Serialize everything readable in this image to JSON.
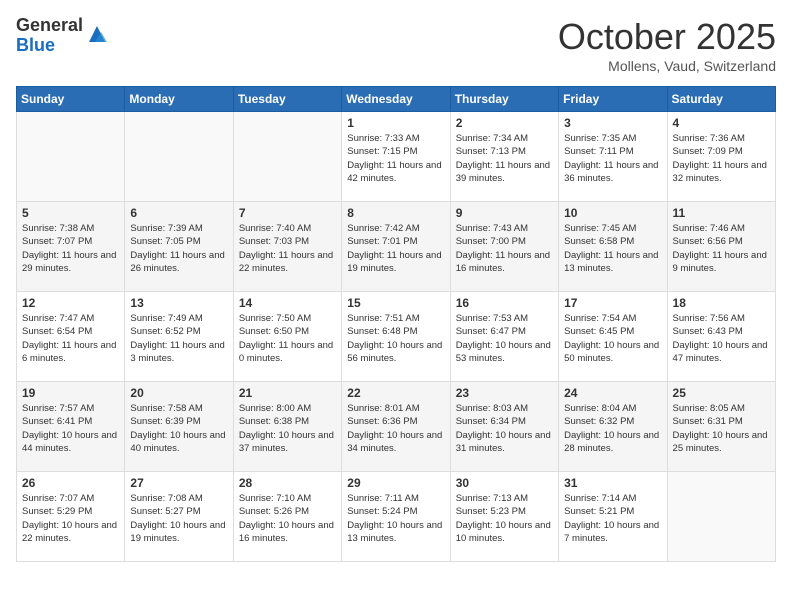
{
  "header": {
    "logo": {
      "general": "General",
      "blue": "Blue"
    },
    "title": "October 2025",
    "location": "Mollens, Vaud, Switzerland"
  },
  "days_of_week": [
    "Sunday",
    "Monday",
    "Tuesday",
    "Wednesday",
    "Thursday",
    "Friday",
    "Saturday"
  ],
  "weeks": [
    [
      {
        "day": "",
        "sunrise": "",
        "sunset": "",
        "daylight": ""
      },
      {
        "day": "",
        "sunrise": "",
        "sunset": "",
        "daylight": ""
      },
      {
        "day": "",
        "sunrise": "",
        "sunset": "",
        "daylight": ""
      },
      {
        "day": "1",
        "sunrise": "Sunrise: 7:33 AM",
        "sunset": "Sunset: 7:15 PM",
        "daylight": "Daylight: 11 hours and 42 minutes."
      },
      {
        "day": "2",
        "sunrise": "Sunrise: 7:34 AM",
        "sunset": "Sunset: 7:13 PM",
        "daylight": "Daylight: 11 hours and 39 minutes."
      },
      {
        "day": "3",
        "sunrise": "Sunrise: 7:35 AM",
        "sunset": "Sunset: 7:11 PM",
        "daylight": "Daylight: 11 hours and 36 minutes."
      },
      {
        "day": "4",
        "sunrise": "Sunrise: 7:36 AM",
        "sunset": "Sunset: 7:09 PM",
        "daylight": "Daylight: 11 hours and 32 minutes."
      }
    ],
    [
      {
        "day": "5",
        "sunrise": "Sunrise: 7:38 AM",
        "sunset": "Sunset: 7:07 PM",
        "daylight": "Daylight: 11 hours and 29 minutes."
      },
      {
        "day": "6",
        "sunrise": "Sunrise: 7:39 AM",
        "sunset": "Sunset: 7:05 PM",
        "daylight": "Daylight: 11 hours and 26 minutes."
      },
      {
        "day": "7",
        "sunrise": "Sunrise: 7:40 AM",
        "sunset": "Sunset: 7:03 PM",
        "daylight": "Daylight: 11 hours and 22 minutes."
      },
      {
        "day": "8",
        "sunrise": "Sunrise: 7:42 AM",
        "sunset": "Sunset: 7:01 PM",
        "daylight": "Daylight: 11 hours and 19 minutes."
      },
      {
        "day": "9",
        "sunrise": "Sunrise: 7:43 AM",
        "sunset": "Sunset: 7:00 PM",
        "daylight": "Daylight: 11 hours and 16 minutes."
      },
      {
        "day": "10",
        "sunrise": "Sunrise: 7:45 AM",
        "sunset": "Sunset: 6:58 PM",
        "daylight": "Daylight: 11 hours and 13 minutes."
      },
      {
        "day": "11",
        "sunrise": "Sunrise: 7:46 AM",
        "sunset": "Sunset: 6:56 PM",
        "daylight": "Daylight: 11 hours and 9 minutes."
      }
    ],
    [
      {
        "day": "12",
        "sunrise": "Sunrise: 7:47 AM",
        "sunset": "Sunset: 6:54 PM",
        "daylight": "Daylight: 11 hours and 6 minutes."
      },
      {
        "day": "13",
        "sunrise": "Sunrise: 7:49 AM",
        "sunset": "Sunset: 6:52 PM",
        "daylight": "Daylight: 11 hours and 3 minutes."
      },
      {
        "day": "14",
        "sunrise": "Sunrise: 7:50 AM",
        "sunset": "Sunset: 6:50 PM",
        "daylight": "Daylight: 11 hours and 0 minutes."
      },
      {
        "day": "15",
        "sunrise": "Sunrise: 7:51 AM",
        "sunset": "Sunset: 6:48 PM",
        "daylight": "Daylight: 10 hours and 56 minutes."
      },
      {
        "day": "16",
        "sunrise": "Sunrise: 7:53 AM",
        "sunset": "Sunset: 6:47 PM",
        "daylight": "Daylight: 10 hours and 53 minutes."
      },
      {
        "day": "17",
        "sunrise": "Sunrise: 7:54 AM",
        "sunset": "Sunset: 6:45 PM",
        "daylight": "Daylight: 10 hours and 50 minutes."
      },
      {
        "day": "18",
        "sunrise": "Sunrise: 7:56 AM",
        "sunset": "Sunset: 6:43 PM",
        "daylight": "Daylight: 10 hours and 47 minutes."
      }
    ],
    [
      {
        "day": "19",
        "sunrise": "Sunrise: 7:57 AM",
        "sunset": "Sunset: 6:41 PM",
        "daylight": "Daylight: 10 hours and 44 minutes."
      },
      {
        "day": "20",
        "sunrise": "Sunrise: 7:58 AM",
        "sunset": "Sunset: 6:39 PM",
        "daylight": "Daylight: 10 hours and 40 minutes."
      },
      {
        "day": "21",
        "sunrise": "Sunrise: 8:00 AM",
        "sunset": "Sunset: 6:38 PM",
        "daylight": "Daylight: 10 hours and 37 minutes."
      },
      {
        "day": "22",
        "sunrise": "Sunrise: 8:01 AM",
        "sunset": "Sunset: 6:36 PM",
        "daylight": "Daylight: 10 hours and 34 minutes."
      },
      {
        "day": "23",
        "sunrise": "Sunrise: 8:03 AM",
        "sunset": "Sunset: 6:34 PM",
        "daylight": "Daylight: 10 hours and 31 minutes."
      },
      {
        "day": "24",
        "sunrise": "Sunrise: 8:04 AM",
        "sunset": "Sunset: 6:32 PM",
        "daylight": "Daylight: 10 hours and 28 minutes."
      },
      {
        "day": "25",
        "sunrise": "Sunrise: 8:05 AM",
        "sunset": "Sunset: 6:31 PM",
        "daylight": "Daylight: 10 hours and 25 minutes."
      }
    ],
    [
      {
        "day": "26",
        "sunrise": "Sunrise: 7:07 AM",
        "sunset": "Sunset: 5:29 PM",
        "daylight": "Daylight: 10 hours and 22 minutes."
      },
      {
        "day": "27",
        "sunrise": "Sunrise: 7:08 AM",
        "sunset": "Sunset: 5:27 PM",
        "daylight": "Daylight: 10 hours and 19 minutes."
      },
      {
        "day": "28",
        "sunrise": "Sunrise: 7:10 AM",
        "sunset": "Sunset: 5:26 PM",
        "daylight": "Daylight: 10 hours and 16 minutes."
      },
      {
        "day": "29",
        "sunrise": "Sunrise: 7:11 AM",
        "sunset": "Sunset: 5:24 PM",
        "daylight": "Daylight: 10 hours and 13 minutes."
      },
      {
        "day": "30",
        "sunrise": "Sunrise: 7:13 AM",
        "sunset": "Sunset: 5:23 PM",
        "daylight": "Daylight: 10 hours and 10 minutes."
      },
      {
        "day": "31",
        "sunrise": "Sunrise: 7:14 AM",
        "sunset": "Sunset: 5:21 PM",
        "daylight": "Daylight: 10 hours and 7 minutes."
      },
      {
        "day": "",
        "sunrise": "",
        "sunset": "",
        "daylight": ""
      }
    ]
  ]
}
